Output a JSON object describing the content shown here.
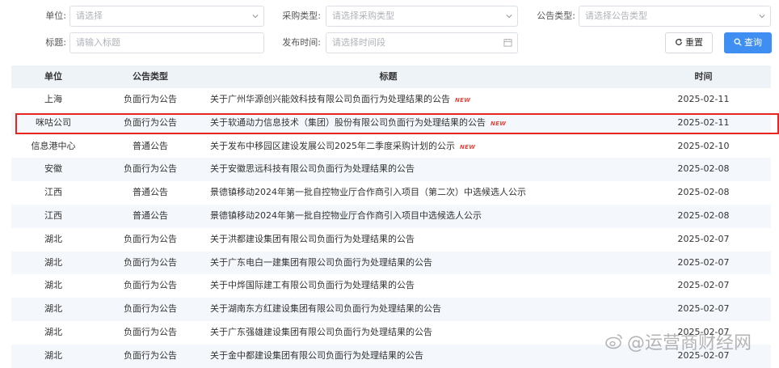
{
  "filters": {
    "unit": {
      "label": "单位:",
      "placeholder": "请选择"
    },
    "purchase_type": {
      "label": "采购类型:",
      "placeholder": "请选择采购类型"
    },
    "notice_type": {
      "label": "公告类型:",
      "placeholder": "请选择公告类型"
    },
    "title": {
      "label": "标题:",
      "placeholder": "请输入标题"
    },
    "publish_time": {
      "label": "发布时间:",
      "placeholder": "请选择时间段"
    },
    "reset_label": "重置",
    "query_label": "查询"
  },
  "table": {
    "headers": {
      "unit": "单位",
      "type": "公告类型",
      "title": "标题",
      "time": "时间"
    },
    "new_tag": "NEW",
    "rows": [
      {
        "unit": "上海",
        "type": "负面行为公告",
        "title": "关于广州华源创兴能效科技有限公司负面行为处理结果的公告",
        "is_new": true,
        "time": "2025-02-11"
      },
      {
        "unit": "咪咕公司",
        "type": "负面行为公告",
        "title": "关于软通动力信息技术（集团）股份有限公司负面行为处理结果的公告",
        "is_new": true,
        "time": "2025-02-11"
      },
      {
        "unit": "信息港中心",
        "type": "普通公告",
        "title": "关于发布中移园区建设发展公司2025年二季度采购计划的公示",
        "is_new": true,
        "time": "2025-02-10"
      },
      {
        "unit": "安徽",
        "type": "负面行为公告",
        "title": "关于安徽思远科技有限公司负面行为处理结果的公告",
        "is_new": false,
        "time": "2025-02-08"
      },
      {
        "unit": "江西",
        "type": "普通公告",
        "title": "景德镇移动2024年第一批自控物业厅合作商引入项目（第二次）中选候选人公示",
        "is_new": false,
        "time": "2025-02-08"
      },
      {
        "unit": "江西",
        "type": "普通公告",
        "title": "景德镇移动2024年第一批自控物业厅合作商引入项目中选候选人公示",
        "is_new": false,
        "time": "2025-02-08"
      },
      {
        "unit": "湖北",
        "type": "负面行为公告",
        "title": "关于洪都建设集团有限公司负面行为处理结果的公告",
        "is_new": false,
        "time": "2025-02-07"
      },
      {
        "unit": "湖北",
        "type": "负面行为公告",
        "title": "关于广东电白一建集团有限公司负面行为处理结果的公告",
        "is_new": false,
        "time": "2025-02-07"
      },
      {
        "unit": "湖北",
        "type": "负面行为公告",
        "title": "关于中烨国际建工有限公司负面行为处理结果的公告",
        "is_new": false,
        "time": "2025-02-07"
      },
      {
        "unit": "湖北",
        "type": "负面行为公告",
        "title": "关于湖南东方红建设集团有限公司负面行为处理结果的公告",
        "is_new": false,
        "time": "2025-02-07"
      },
      {
        "unit": "湖北",
        "type": "负面行为公告",
        "title": "关于广东强雄建设集团有限公司负面行为处理结果的公告",
        "is_new": false,
        "time": "2025-02-07"
      },
      {
        "unit": "湖北",
        "type": "负面行为公告",
        "title": "关于金中都建设集团有限公司负面行为处理结果的公告",
        "is_new": false,
        "time": "2025-02-07"
      }
    ]
  },
  "watermark": {
    "text": "@运营商财经网"
  },
  "colors": {
    "accent": "#3f8ef2",
    "highlight": "#e8251f",
    "new_tag": "#e8453c"
  }
}
